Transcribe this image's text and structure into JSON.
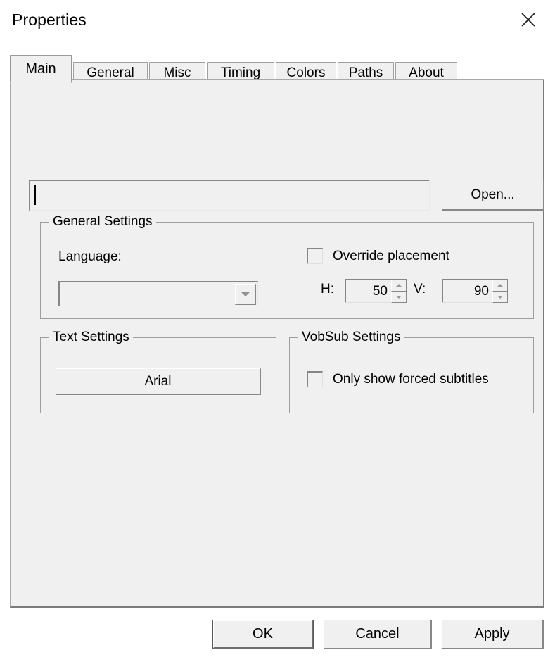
{
  "window": {
    "title": "Properties",
    "close_icon": "close-icon"
  },
  "tabs": [
    {
      "label": "Main",
      "selected": true
    },
    {
      "label": "General",
      "selected": false
    },
    {
      "label": "Misc",
      "selected": false
    },
    {
      "label": "Timing",
      "selected": false
    },
    {
      "label": "Colors",
      "selected": false
    },
    {
      "label": "Paths",
      "selected": false
    },
    {
      "label": "About",
      "selected": false
    }
  ],
  "main_tab": {
    "file": {
      "value": "",
      "placeholder": "",
      "open_label": "Open..."
    },
    "general_settings": {
      "legend": "General Settings",
      "language_label": "Language:",
      "language_value": "",
      "dropdown_icon": "chevron-down-icon",
      "override_placement": {
        "label": "Override placement",
        "checked": false
      },
      "horizontal": {
        "label": "H:",
        "value": "50"
      },
      "vertical": {
        "label": "V:",
        "value": "90"
      }
    },
    "text_settings": {
      "legend": "Text Settings",
      "font_button_label": "Arial"
    },
    "vobsub_settings": {
      "legend": "VobSub Settings",
      "only_forced": {
        "label": "Only show forced subtitles",
        "checked": false
      }
    }
  },
  "footer": {
    "ok_label": "OK",
    "cancel_label": "Cancel",
    "apply_label": "Apply"
  },
  "colors": {
    "dialog_background": "#ffffff",
    "panel_background": "#f0f0f0",
    "border": "#a0a0a0",
    "shadow": "#878787",
    "text": "#000000"
  }
}
